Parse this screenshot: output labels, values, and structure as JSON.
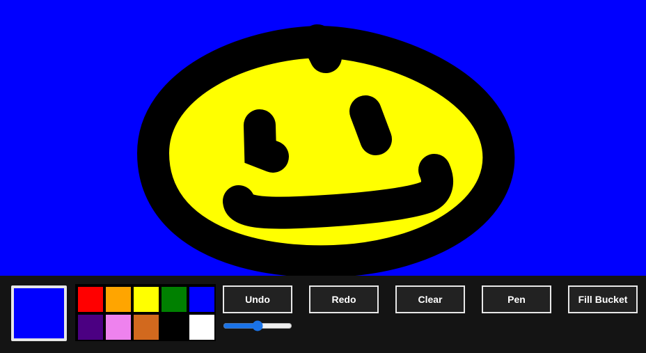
{
  "canvas": {
    "background": "#0000FF",
    "stroke_color": "#000000",
    "fill_color": "#FFFF00"
  },
  "current_color": "#0000FF",
  "palette": [
    {
      "name": "red",
      "hex": "#FF0000"
    },
    {
      "name": "orange",
      "hex": "#FFA500"
    },
    {
      "name": "yellow",
      "hex": "#FFFF00"
    },
    {
      "name": "green",
      "hex": "#008000"
    },
    {
      "name": "blue",
      "hex": "#0000FF"
    },
    {
      "name": "indigo",
      "hex": "#4B0082"
    },
    {
      "name": "violet",
      "hex": "#EE82EE"
    },
    {
      "name": "chocolate",
      "hex": "#D2691E"
    },
    {
      "name": "black",
      "hex": "#000000"
    },
    {
      "name": "white",
      "hex": "#FFFFFF"
    }
  ],
  "toolbar": {
    "undo_label": "Undo",
    "redo_label": "Redo",
    "clear_label": "Clear",
    "pen_label": "Pen",
    "fill_label": "Fill Bucket"
  },
  "brush_size": {
    "min": 1,
    "max": 100,
    "value": 50
  }
}
